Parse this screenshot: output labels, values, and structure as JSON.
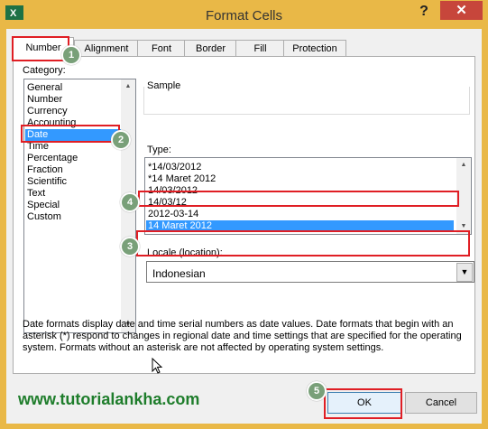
{
  "window": {
    "title": "Format Cells",
    "help_glyph": "?",
    "close_glyph": "✕"
  },
  "tabs": [
    {
      "label": "Number"
    },
    {
      "label": "Alignment"
    },
    {
      "label": "Font"
    },
    {
      "label": "Border"
    },
    {
      "label": "Fill"
    },
    {
      "label": "Protection"
    }
  ],
  "category": {
    "label": "Category:",
    "items": [
      "General",
      "Number",
      "Currency",
      "Accounting",
      "Date",
      "Time",
      "Percentage",
      "Fraction",
      "Scientific",
      "Text",
      "Special",
      "Custom"
    ],
    "selected": "Date"
  },
  "sample": {
    "label": "Sample"
  },
  "type": {
    "label": "Type:",
    "items": [
      "*14/03/2012",
      "*14 Maret 2012",
      "14/03/2012",
      "14/03/12",
      "2012-03-14",
      "14 Maret 2012"
    ],
    "selected": "14 Maret 2012"
  },
  "locale": {
    "label": "Locale (location):",
    "value": "Indonesian"
  },
  "description": "Date formats display date and time serial numbers as date values.  Date formats that begin with an asterisk (*) respond to changes in regional date and time settings that are specified for the operating system. Formats without an asterisk are not affected by operating system settings.",
  "buttons": {
    "ok": "OK",
    "cancel": "Cancel"
  },
  "annotations": [
    "1",
    "2",
    "3",
    "4",
    "5"
  ],
  "watermark": "www.tutorialankha.com",
  "colors": {
    "highlight": "#3399ff",
    "annotation_red": "#e01e24",
    "badge": "#79a079",
    "titlebar": "#e9b847",
    "close": "#c7463b"
  }
}
